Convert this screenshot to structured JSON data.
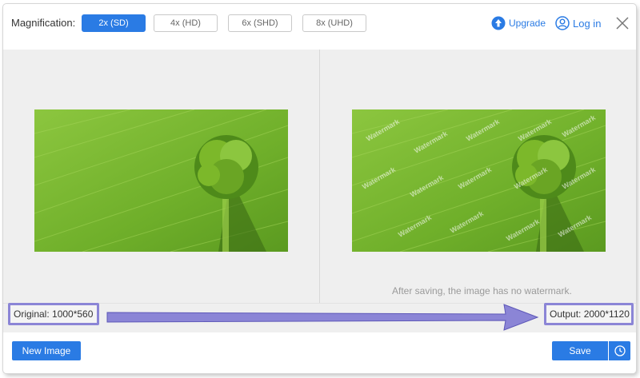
{
  "header": {
    "magnification_label": "Magnification:",
    "options": [
      {
        "label": "2x (SD)",
        "active": true
      },
      {
        "label": "4x (HD)",
        "active": false
      },
      {
        "label": "6x (SHD)",
        "active": false
      },
      {
        "label": "8x (UHD)",
        "active": false
      }
    ],
    "upgrade_label": "Upgrade",
    "login_label": "Log in",
    "close_icon": "close-icon"
  },
  "preview": {
    "original_image": "aerial-field-tree-photo",
    "output_image": "aerial-field-tree-photo-watermarked",
    "watermark_text": "Watermark",
    "note": "After saving, the image has no watermark."
  },
  "info": {
    "original": "Original: 1000*560",
    "output": "Output: 2000*1120",
    "annotation_color": "#8b85d6"
  },
  "footer": {
    "new_image_label": "New Image",
    "save_label": "Save",
    "history_icon": "clock-icon"
  },
  "colors": {
    "accent": "#2a7be4",
    "pane_bg": "#efefef",
    "grass": "#7cb82a"
  }
}
